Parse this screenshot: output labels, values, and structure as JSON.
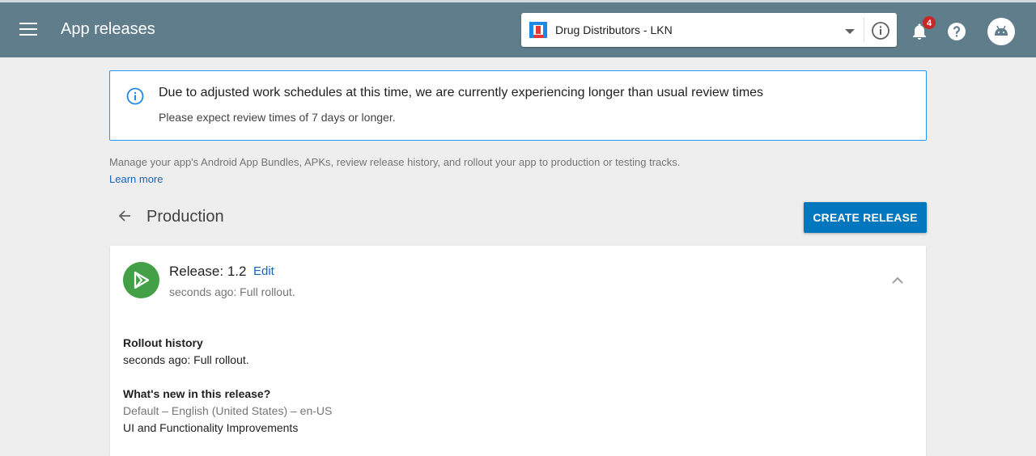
{
  "header": {
    "title": "App releases",
    "selected_app": "Drug Distributors - LKN",
    "notification_count": "4"
  },
  "notice": {
    "title": "Due to adjusted work schedules at this time, we are currently experiencing longer than usual review times",
    "text": "Please expect review times of 7 days or longer."
  },
  "description": "Manage your app's Android App Bundles, APKs, review release history, and rollout your app to production or testing tracks.",
  "learn_more": "Learn more",
  "section": {
    "title": "Production",
    "create_label": "CREATE RELEASE"
  },
  "release": {
    "title": "Release: 1.2",
    "edit_label": "Edit",
    "status": "seconds ago: Full rollout.",
    "rollout_history_label": "Rollout history",
    "rollout_history_value": "seconds ago: Full rollout.",
    "whats_new_label": "What's new in this release?",
    "whats_new_locale": "Default – English (United States) – en-US",
    "whats_new_text": "UI and Functionality Improvements"
  },
  "colors": {
    "appbar": "#607d8b",
    "primary_button": "#0277bd",
    "notice_border": "#2196f3",
    "release_icon": "#43a047",
    "badge": "#c62828"
  },
  "icons": [
    "menu-icon",
    "app-logo-icon",
    "dropdown-caret-icon",
    "info-icon",
    "bell-icon",
    "help-icon",
    "android-icon",
    "notice-info-icon",
    "back-arrow-icon",
    "play-icon",
    "chevron-up-icon"
  ]
}
